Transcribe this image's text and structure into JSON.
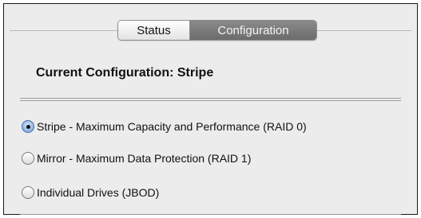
{
  "tabs": {
    "status_label": "Status",
    "configuration_label": "Configuration",
    "selected": "Configuration"
  },
  "current_configuration": {
    "title": "Current Configuration:  Stripe"
  },
  "raid_options": [
    {
      "label": "Stripe - Maximum Capacity and Performance (RAID 0)",
      "selected": true
    },
    {
      "label": "Mirror - Maximum Data Protection (RAID 1)",
      "selected": false
    },
    {
      "label": "Individual Drives (JBOD)",
      "selected": false
    }
  ],
  "colors": {
    "panel_background": "#ececec",
    "selected_tab": "#6c6c6c",
    "selected_radio": "#7ea7e0"
  }
}
